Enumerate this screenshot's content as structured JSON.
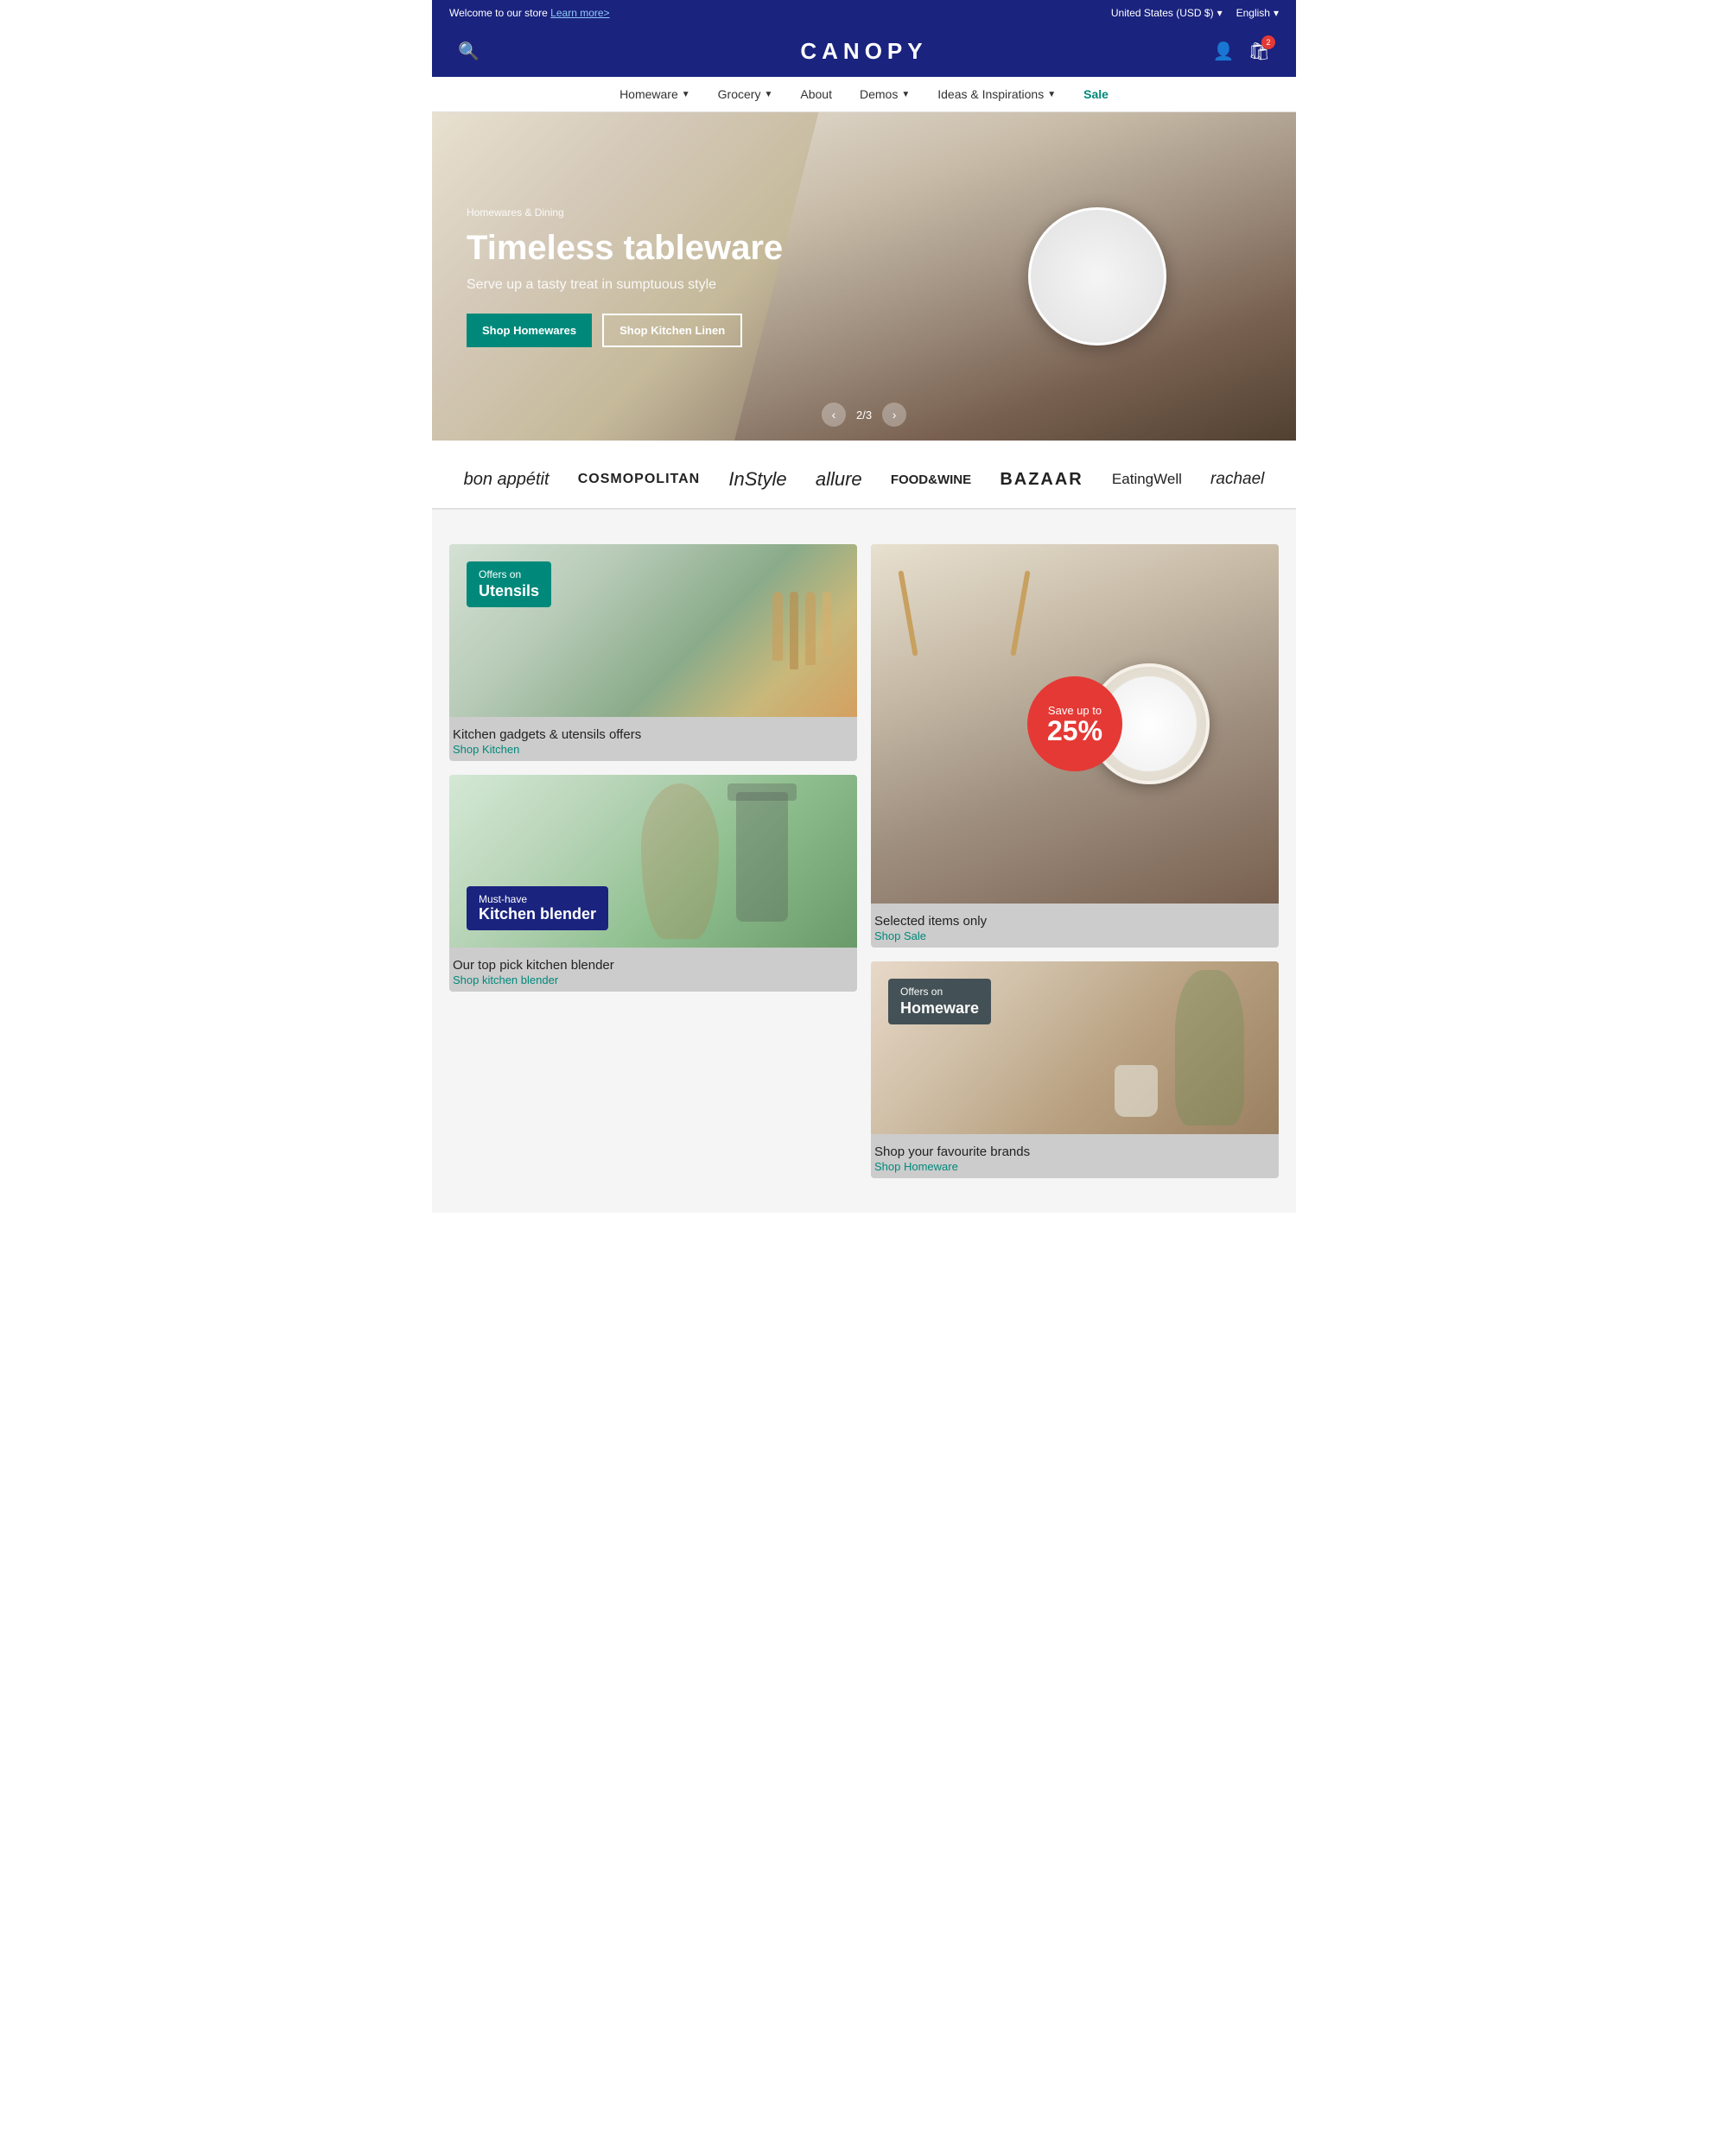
{
  "topbar": {
    "welcome_text": "Welcome to our store",
    "learn_more": "Learn more>",
    "region": "United States (USD $)",
    "language": "English"
  },
  "header": {
    "logo": "CANOPY",
    "search_label": "search",
    "account_label": "account",
    "cart_label": "cart",
    "cart_count": "2"
  },
  "nav": {
    "items": [
      {
        "label": "Homeware",
        "has_dropdown": true
      },
      {
        "label": "Grocery",
        "has_dropdown": true
      },
      {
        "label": "About",
        "has_dropdown": false
      },
      {
        "label": "Demos",
        "has_dropdown": true
      },
      {
        "label": "Ideas & Inspirations",
        "has_dropdown": true
      },
      {
        "label": "Sale",
        "has_dropdown": false,
        "is_sale": true
      }
    ]
  },
  "hero": {
    "breadcrumb": "Homewares & Dining",
    "title": "Timeless tableware",
    "subtitle": "Serve up a tasty treat in sumptuous style",
    "btn_primary": "Shop Homewares",
    "btn_secondary": "Shop Kitchen Linen",
    "slide_current": "2",
    "slide_total": "3"
  },
  "brands": [
    {
      "name": "bon appétit",
      "class": "bon-appetit"
    },
    {
      "name": "COSMOPOLITAN",
      "class": "cosmo"
    },
    {
      "name": "InStyle",
      "class": "instyle"
    },
    {
      "name": "allure",
      "class": "allure"
    },
    {
      "name": "FOOD&WINE",
      "class": "food-wine"
    },
    {
      "name": "BAZAAR",
      "class": "bazaar"
    },
    {
      "name": "EatingWell",
      "class": "eating-well"
    },
    {
      "name": "rachael",
      "class": "rachael"
    }
  ],
  "promo_cards": {
    "utensils": {
      "badge_title": "Offers on",
      "badge_main": "Utensils",
      "card_title": "Kitchen gadgets & utensils offers",
      "link_text": "Shop Kitchen",
      "link_href": "#"
    },
    "tableware": {
      "save_title": "Save up to",
      "save_amount": "25%",
      "card_title": "Selected items only",
      "link_text": "Shop Sale",
      "link_href": "#"
    },
    "blender": {
      "badge_title": "Must-have",
      "badge_main": "Kitchen blender",
      "card_title": "Our top pick kitchen blender",
      "link_text": "Shop kitchen blender",
      "link_href": "#"
    },
    "homeware": {
      "badge_title": "Offers on",
      "badge_main": "Homeware",
      "card_title": "Shop your favourite brands",
      "link_text": "Shop Homeware",
      "link_href": "#"
    }
  }
}
